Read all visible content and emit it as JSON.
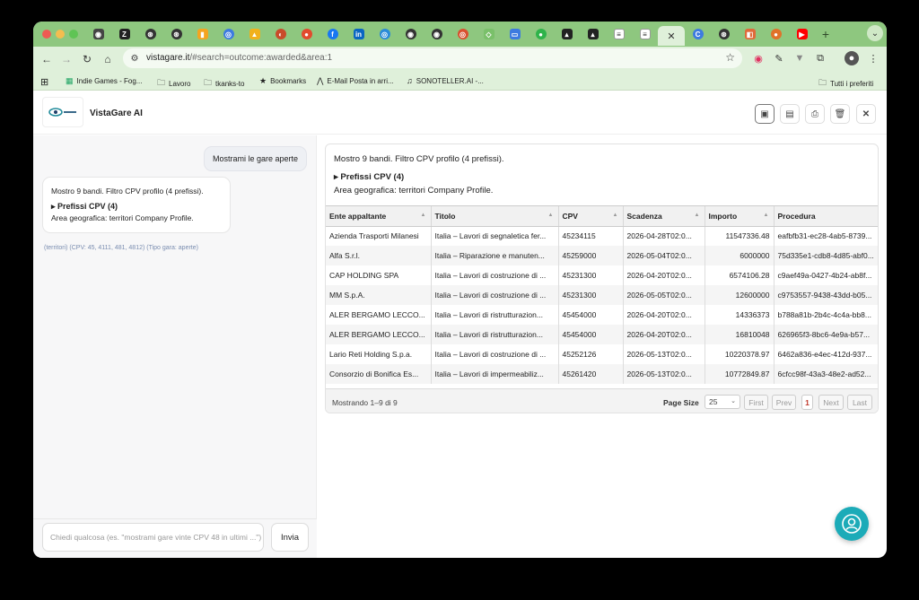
{
  "browser": {
    "url_host": "vistagare.it",
    "url_rest": "/#search=outcome:awarded&area:1",
    "active_tab_close": "✕",
    "new_tab": "+",
    "bookmarks": [
      {
        "label": "Indie Games - Fog...",
        "icon": "sheets-icon"
      },
      {
        "label": "Lavoro",
        "icon": "folder-icon"
      },
      {
        "label": "tkanks-to",
        "icon": "folder-icon"
      },
      {
        "label": "Bookmarks",
        "icon": "star-icon"
      },
      {
        "label": "E-Mail Posta in arri...",
        "icon": "mail-icon"
      },
      {
        "label": "SONOTELLER.AI -...",
        "icon": "music-icon"
      }
    ],
    "other_bookmarks": "Tutti i preferiti"
  },
  "app": {
    "title": "VistaGare AI"
  },
  "chat": {
    "user_message": "Mostrami le gare aperte",
    "bot_line1": "Mostro 9 bandi. Filtro CPV profilo (4 prefissi).",
    "bot_line2": "▸ Prefissi CPV (4)",
    "bot_line3": "Area geografica: territori Company Profile.",
    "meta": "(territori) (CPV: 45, 4111, 481, 4812) (Tipo gara: aperte)",
    "input_placeholder": "Chiedi qualcosa (es. \"mostrami gare vinte CPV 48 in ultimi ...\")",
    "send_label": "Invia"
  },
  "results": {
    "summary": "Mostro 9 bandi. Filtro CPV profilo (4 prefissi).",
    "cpv_toggle": "▸ Prefissi CPV (4)",
    "area": "Area geografica: territori Company Profile.",
    "columns": [
      "Ente appaltante",
      "Titolo",
      "CPV",
      "Scadenza",
      "Importo",
      "Procedura"
    ],
    "rows": [
      [
        "Azienda Trasporti Milanesi",
        "Italia – Lavori di segnaletica fer...",
        "45234115",
        "2026-04-28T02:0...",
        "11547336.48",
        "eafbfb31-ec28-4ab5-8739..."
      ],
      [
        "Alfa S.r.l.",
        "Italia – Riparazione e manuten...",
        "45259000",
        "2026-05-04T02:0...",
        "6000000",
        "75d335e1-cdb8-4d85-abf0..."
      ],
      [
        "CAP HOLDING SPA",
        "Italia – Lavori di costruzione di ...",
        "45231300",
        "2026-04-20T02:0...",
        "6574106.28",
        "c9aef49a-0427-4b24-ab8f..."
      ],
      [
        "MM S.p.A.",
        "Italia – Lavori di costruzione di ...",
        "45231300",
        "2026-05-05T02:0...",
        "12600000",
        "c9753557-9438-43dd-b05..."
      ],
      [
        "ALER BERGAMO LECCO...",
        "Italia – Lavori di ristrutturazion...",
        "45454000",
        "2026-04-20T02:0...",
        "14336373",
        "b788a81b-2b4c-4c4a-bb8..."
      ],
      [
        "ALER BERGAMO LECCO...",
        "Italia – Lavori di ristrutturazion...",
        "45454000",
        "2026-04-20T02:0...",
        "16810048",
        "626965f3-8bc6-4e9a-b57..."
      ],
      [
        "Lario Reti Holding S.p.a.",
        "Italia – Lavori di costruzione di ...",
        "45252126",
        "2026-05-13T02:0...",
        "10220378.97",
        "6462a836-e4ec-412d-937..."
      ],
      [
        "Consorzio di Bonifica Es...",
        "Italia – Lavori di impermeabiliz...",
        "45261420",
        "2026-05-13T02:0...",
        "10772849.87",
        "6cfcc98f-43a3-48e2-ad52..."
      ]
    ],
    "pager": {
      "status": "Mostrando 1–9 di 9",
      "page_size_label": "Page Size",
      "page_size": "25",
      "first": "First",
      "prev": "Prev",
      "current": "1",
      "next": "Next",
      "last": "Last"
    }
  },
  "colors": {
    "tabstrip": "#8ec77f",
    "toolbar": "#dff0da",
    "fab": "#1cabb8"
  }
}
